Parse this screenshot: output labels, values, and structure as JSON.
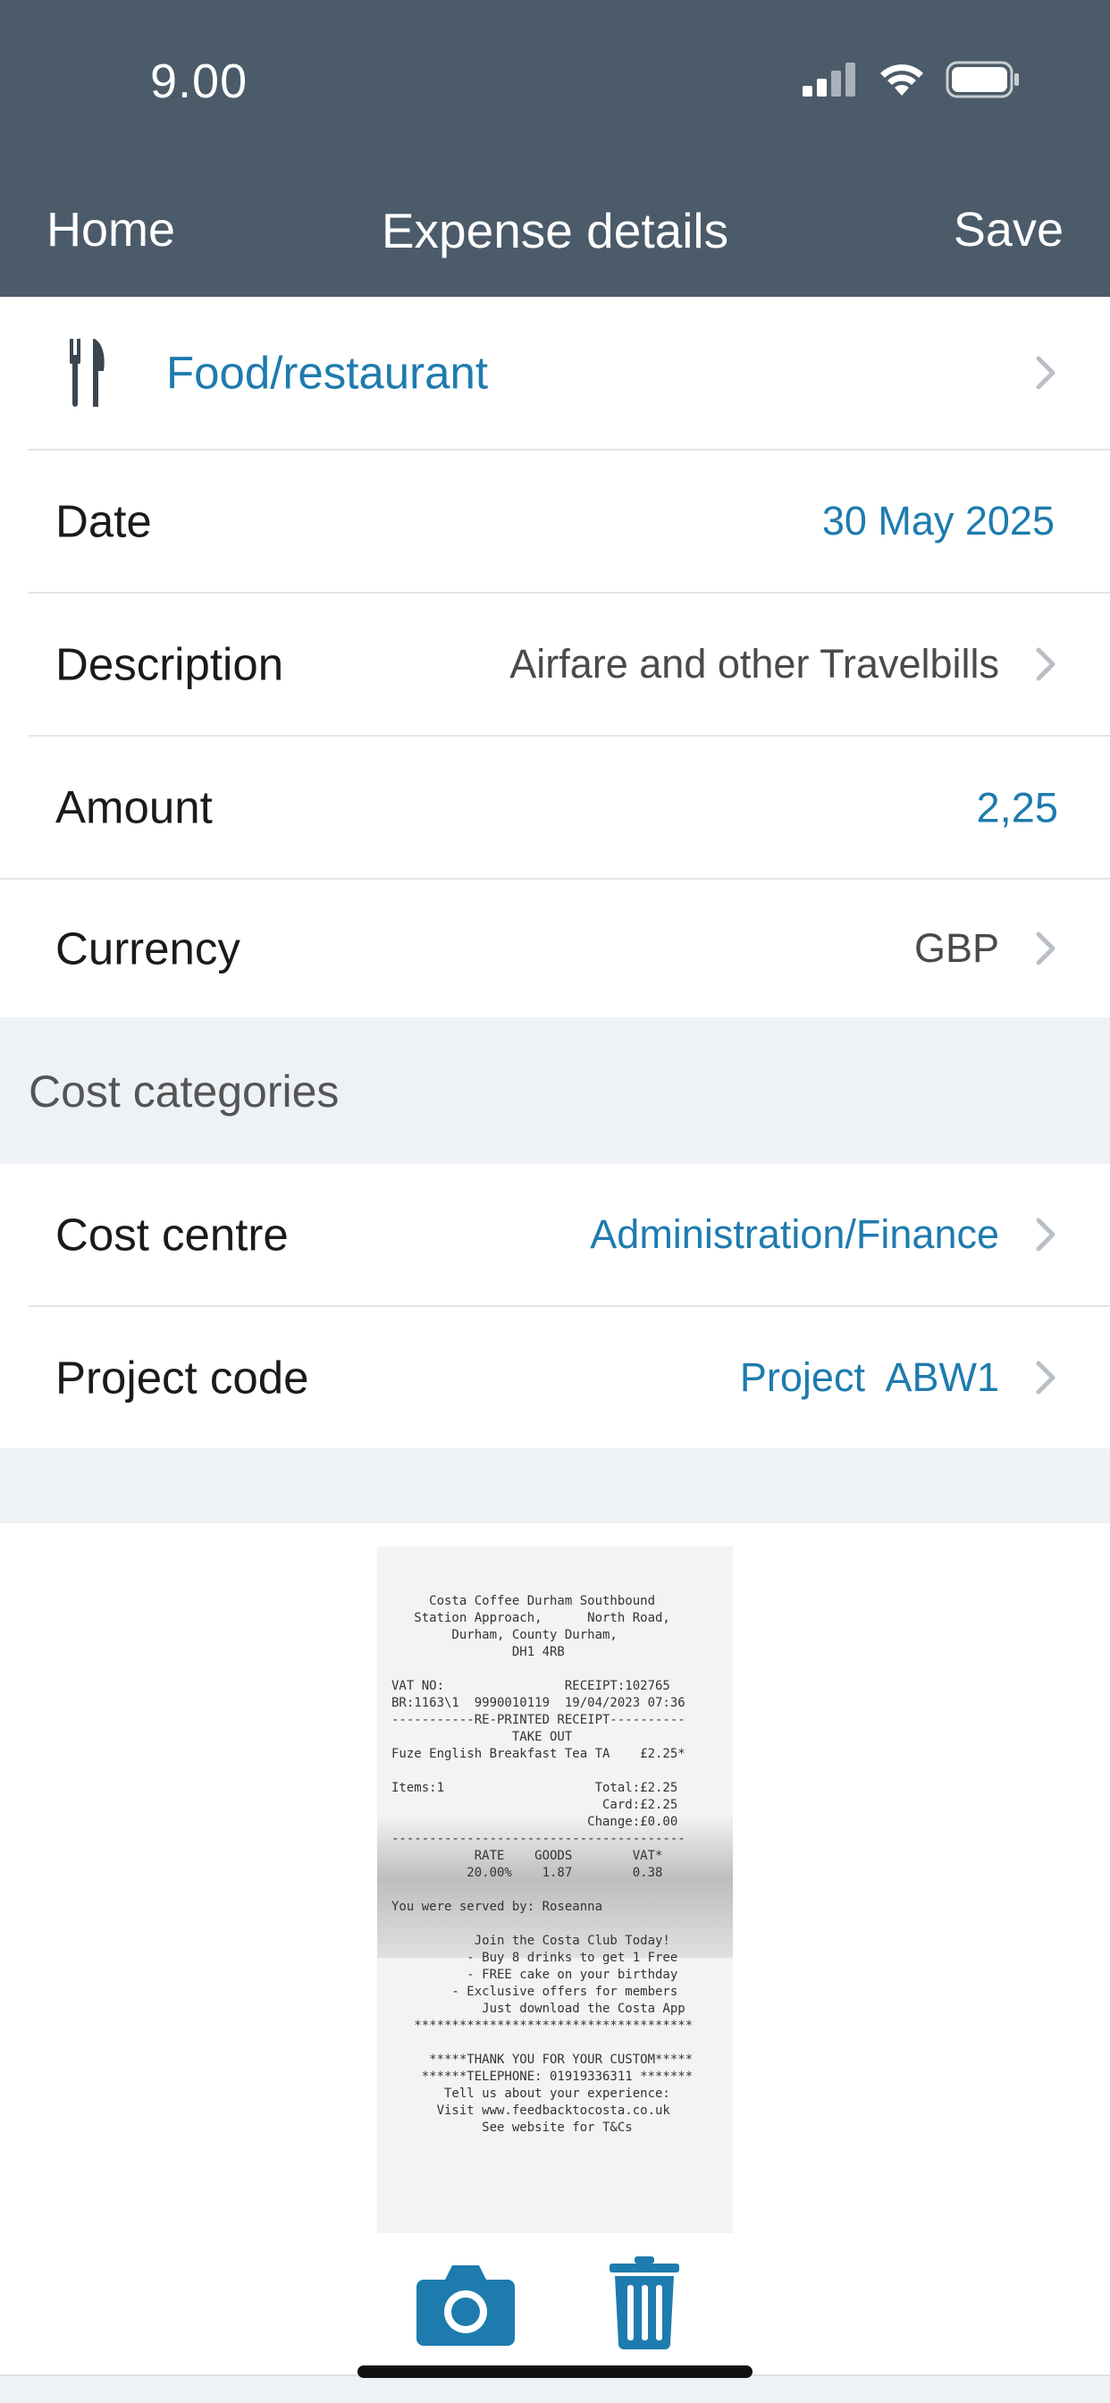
{
  "status_bar": {
    "time": "9.00",
    "icons": [
      "cellular-signal-icon",
      "wifi-icon",
      "battery-icon"
    ]
  },
  "nav": {
    "back_label": "Home",
    "title": "Expense details",
    "save_label": "Save"
  },
  "category": {
    "icon": "fork-knife-icon",
    "label": "Food/restaurant"
  },
  "fields": {
    "date": {
      "label": "Date",
      "value": "30 May 2025"
    },
    "description": {
      "label": "Description",
      "value": "Airfare and other Travelbills"
    },
    "amount": {
      "label": "Amount",
      "value": "2,25"
    },
    "currency": {
      "label": "Currency",
      "value": "GBP"
    }
  },
  "cost_categories": {
    "header": "Cost categories",
    "cost_centre": {
      "label": "Cost centre",
      "value": "Administration/Finance"
    },
    "project_code": {
      "label": "Project code",
      "value": "Project  ABW1"
    }
  },
  "receipt": {
    "text": "     Costa Coffee Durham Southbound\n   Station Approach,      North Road,\n        Durham, County Durham,\n                DH1 4RB\n\nVAT NO:                RECEIPT:102765\nBR:1163\\1  9990010119  19/04/2023 07:36\n-----------RE-PRINTED RECEIPT----------\n                TAKE OUT\nFuze English Breakfast Tea TA    £2.25*\n\nItems:1                    Total:£2.25\n                            Card:£2.25\n                          Change:£0.00\n---------------------------------------\n           RATE    GOODS        VAT*\n          20.00%    1.87        0.38\n\nYou were served by: Roseanna\n\n           Join the Costa Club Today!\n          - Buy 8 drinks to get 1 Free\n          - FREE cake on your birthday\n        - Exclusive offers for members\n            Just download the Costa App\n   *************************************\n\n     *****THANK YOU FOR YOUR CUSTOM*****\n    ******TELEPHONE: 01919336311 *******\n       Tell us about your experience:\n      Visit www.feedbacktocosta.co.uk\n            See website for T&Cs"
  },
  "toolbar": {
    "camera_icon": "camera-icon",
    "delete_icon": "trash-icon"
  },
  "colors": {
    "header_bg": "#4b5b69",
    "accent_blue": "#1e7bae",
    "grouped_bg": "#eef2f6"
  }
}
